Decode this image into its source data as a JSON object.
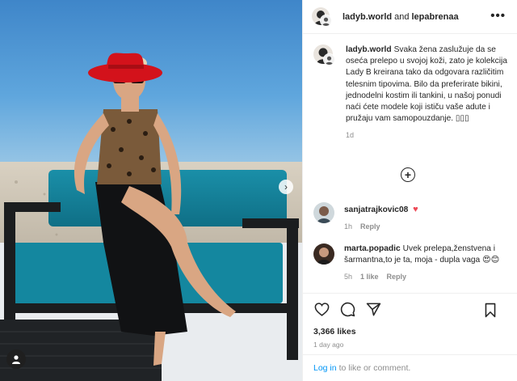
{
  "header": {
    "author": "ladyb.world",
    "joiner": "and",
    "collaborator": "lepabrenaa",
    "more_icon": "more-horizontal-icon"
  },
  "caption": {
    "username": "ladyb.world",
    "text": "Svaka žena zaslužuje da se oseća prelepo u svojoj koži, zato je kolekcija Lady B kreirana tako da odgovara različitim telesnim tipovima. Bilo da preferirate bikini, jednodelni kostim ili tankini, u našoj ponudi naći ćete modele koji ističu vaše adute i pružaju vam samopouzdanje. ▯▯▯",
    "time": "1d"
  },
  "load_more_icon": "plus-circle-icon",
  "comments": [
    {
      "username": "sanjatrajkovic08",
      "text": "",
      "emoji": "♥",
      "time": "1h",
      "reply": "Reply"
    },
    {
      "username": "marta.popadic",
      "text": "Uvek prelepa,ženstvena i šarmantna,to je ta, moja - dupla vaga 😍😊",
      "time": "5h",
      "likes": "1 like",
      "reply": "Reply"
    }
  ],
  "actions": {
    "like_icon": "heart-icon",
    "comment_icon": "comment-icon",
    "share_icon": "share-icon",
    "save_icon": "bookmark-icon"
  },
  "likes": "3,366 likes",
  "date": "1 day ago",
  "comment_bar": {
    "login_link": "Log in",
    "rest": "to like or comment."
  },
  "colors": {
    "link_blue": "#0095f6",
    "heart_red": "#ed4956",
    "muted_gray": "#8e8e8e"
  }
}
